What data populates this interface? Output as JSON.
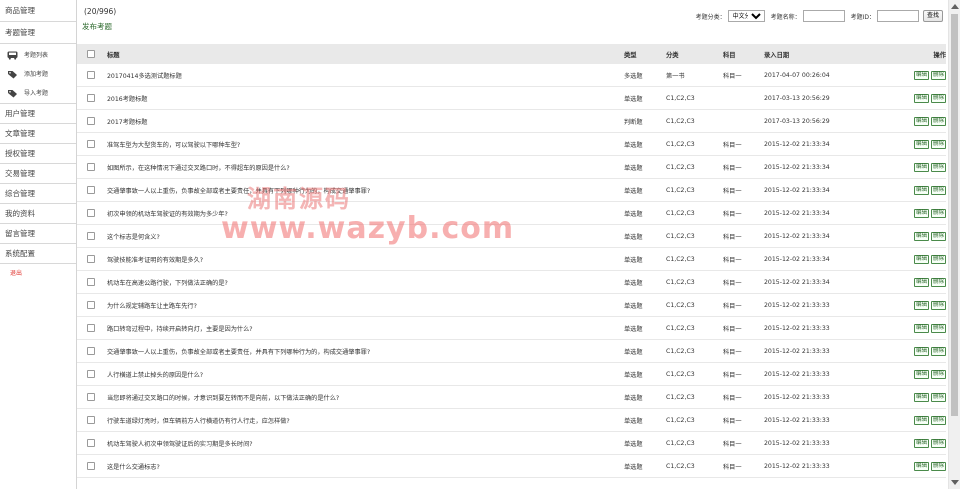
{
  "sidebar": {
    "items": [
      {
        "label": "商品管理"
      },
      {
        "label": "考题管理"
      }
    ],
    "sub_items": [
      {
        "label": "考题列表",
        "icon": "bus-icon"
      },
      {
        "label": "添加考题",
        "icon": "tag-icon"
      },
      {
        "label": "导入考题",
        "icon": "tag-icon"
      }
    ],
    "items_after": [
      {
        "label": "用户管理"
      },
      {
        "label": "文章管理"
      },
      {
        "label": "授权管理"
      },
      {
        "label": "交易管理"
      },
      {
        "label": "综合管理"
      },
      {
        "label": "我的资料"
      },
      {
        "label": "留言管理"
      },
      {
        "label": "系统配置"
      }
    ],
    "logout_label": "退出"
  },
  "header": {
    "count": "(20/996)",
    "publish_label": "发布考题"
  },
  "filter": {
    "category_label": "考题分类：",
    "category_value": "中文分类",
    "name_label": "考题名称：",
    "id_label": "考题ID：",
    "search_label": "查找"
  },
  "table": {
    "headers": {
      "title": "标题",
      "type": "类型",
      "category": "分类",
      "subject": "科目",
      "date": "录入日期",
      "ops": "操作"
    },
    "edit_label": "编辑",
    "delete_label": "删除",
    "rows": [
      {
        "title": "20170414多选测试题标题",
        "type": "多选题",
        "category": "第一书",
        "subject": "科目一",
        "date": "2017-04-07 00:26:04"
      },
      {
        "title": "2016考题标题",
        "type": "单选题",
        "category": "C1,C2,C3",
        "subject": "",
        "date": "2017-03-13 20:56:29"
      },
      {
        "title": "2017考题标题",
        "type": "判断题",
        "category": "C1,C2,C3",
        "subject": "",
        "date": "2017-03-13 20:56:29"
      },
      {
        "title": "准驾车型为大型货车的，可以驾驶以下哪种车型?",
        "type": "单选题",
        "category": "C1,C2,C3",
        "subject": "科目一",
        "date": "2015-12-02 21:33:34"
      },
      {
        "title": "如图所示，在这种情况下通过交叉路口时，不得超车的原因是什么?",
        "type": "单选题",
        "category": "C1,C2,C3",
        "subject": "科目一",
        "date": "2015-12-02 21:33:34"
      },
      {
        "title": "交通肇事致一人以上重伤，负事故全部或者主要责任，并具有下列哪种行为的，构成交通肇事罪?",
        "type": "单选题",
        "category": "C1,C2,C3",
        "subject": "科目一",
        "date": "2015-12-02 21:33:34"
      },
      {
        "title": "初次申领的机动车驾驶证的有效期为多少年?",
        "type": "单选题",
        "category": "C1,C2,C3",
        "subject": "科目一",
        "date": "2015-12-02 21:33:34"
      },
      {
        "title": "这个标志是何含义?",
        "type": "单选题",
        "category": "C1,C2,C3",
        "subject": "科目一",
        "date": "2015-12-02 21:33:34"
      },
      {
        "title": "驾驶技能准考证明的有效期是多久?",
        "type": "单选题",
        "category": "C1,C2,C3",
        "subject": "科目一",
        "date": "2015-12-02 21:33:34"
      },
      {
        "title": "机动车在高速公路行驶，下列做法正确的是?",
        "type": "单选题",
        "category": "C1,C2,C3",
        "subject": "科目一",
        "date": "2015-12-02 21:33:34"
      },
      {
        "title": "为什么规定辅路车让主路车先行?",
        "type": "单选题",
        "category": "C1,C2,C3",
        "subject": "科目一",
        "date": "2015-12-02 21:33:33"
      },
      {
        "title": "路口转弯过程中，持续开启转向灯，主要是因为什么?",
        "type": "单选题",
        "category": "C1,C2,C3",
        "subject": "科目一",
        "date": "2015-12-02 21:33:33"
      },
      {
        "title": "交通肇事致一人以上重伤，负事故全部或者主要责任，并具有下列哪种行为的，构成交通肇事罪?",
        "type": "单选题",
        "category": "C1,C2,C3",
        "subject": "科目一",
        "date": "2015-12-02 21:33:33"
      },
      {
        "title": "人行横道上禁止掉头的原因是什么?",
        "type": "单选题",
        "category": "C1,C2,C3",
        "subject": "科目一",
        "date": "2015-12-02 21:33:33"
      },
      {
        "title": "当您即将通过交叉路口的时候，才意识到要左转而不是向前，以下做法正确的是什么?",
        "type": "单选题",
        "category": "C1,C2,C3",
        "subject": "科目一",
        "date": "2015-12-02 21:33:33"
      },
      {
        "title": "行驶车道绿灯亮时，但车辆前方人行横道仍有行人行走，应怎样做?",
        "type": "单选题",
        "category": "C1,C2,C3",
        "subject": "科目一",
        "date": "2015-12-02 21:33:33"
      },
      {
        "title": "机动车驾驶人初次申领驾驶证后的实习期是多长时间?",
        "type": "单选题",
        "category": "C1,C2,C3",
        "subject": "科目一",
        "date": "2015-12-02 21:33:33"
      },
      {
        "title": "这是什么交通标志?",
        "type": "单选题",
        "category": "C1,C2,C3",
        "subject": "科目一",
        "date": "2015-12-02 21:33:33"
      }
    ]
  },
  "watermark": {
    "line1": "湖南源码",
    "line2": "www.wazyb.com"
  }
}
